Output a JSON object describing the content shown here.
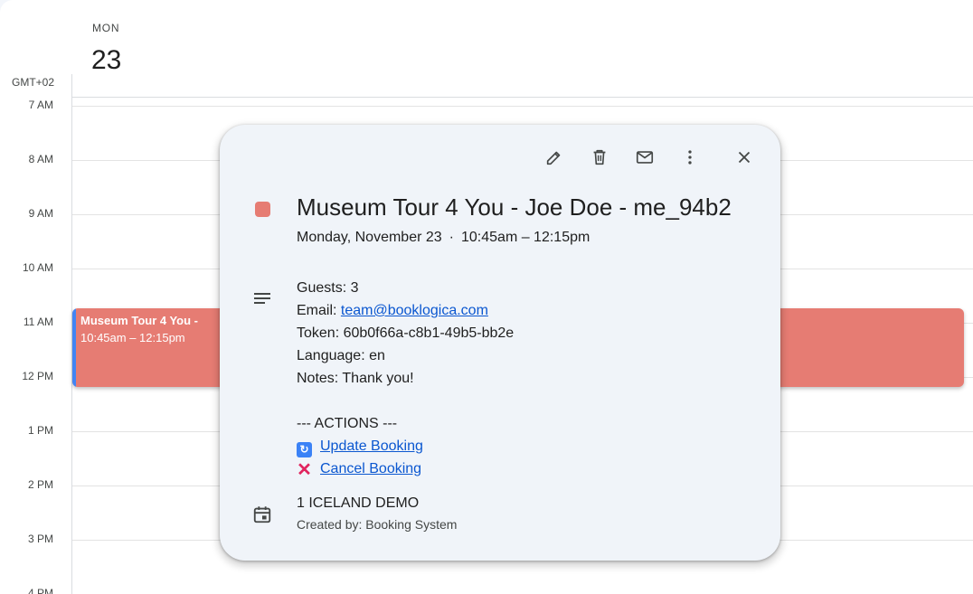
{
  "header": {
    "day_name": "MON",
    "day_number": "23",
    "timezone": "GMT+02"
  },
  "hours": [
    "7 AM",
    "8 AM",
    "9 AM",
    "10 AM",
    "11 AM",
    "12 PM",
    "1 PM",
    "2 PM",
    "3 PM",
    "4 PM"
  ],
  "event": {
    "title": "Museum Tour 4 You -",
    "time": "10:45am – 12:15pm",
    "color": "#e67c73",
    "accent": "#4285f4"
  },
  "popup": {
    "toolbar": [
      "edit-icon",
      "delete-icon",
      "email-icon",
      "more-options-icon",
      "close-icon"
    ],
    "title": "Museum Tour 4 You - Joe Doe - me_94b2",
    "date": "Monday, November 23",
    "separator": "·",
    "time_range": "10:45am – 12:15pm",
    "description": {
      "guests": "Guests: 3",
      "email_label": "Email: ",
      "email": "team@booklogica.com",
      "token": "Token: 60b0f66a-c8b1-49b5-bb2e",
      "language": "Language: en",
      "notes": "Notes: Thank you!",
      "actions_header": "--- ACTIONS ---",
      "update_link": "Update Booking",
      "cancel_link": "Cancel Booking"
    },
    "calendar_name": "1 ICELAND DEMO",
    "created_by": "Created by: Booking System"
  }
}
